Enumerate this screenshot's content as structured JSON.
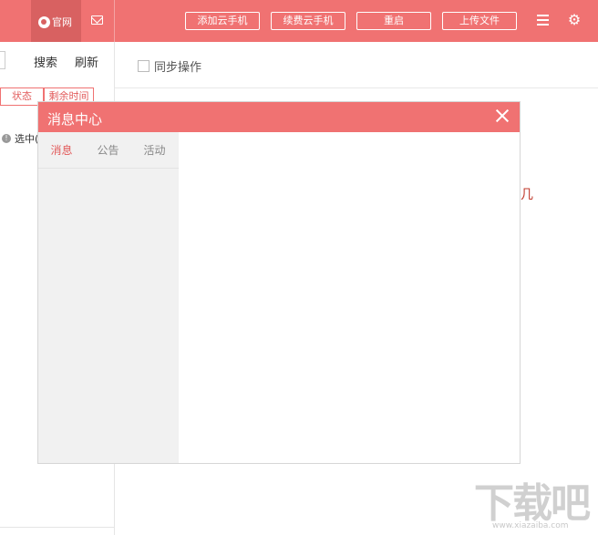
{
  "topbar": {
    "site_label": "官网",
    "buttons": {
      "add_phone": "添加云手机",
      "renew_phone": "续费云手机",
      "restart": "重启",
      "upload_file": "上传文件"
    },
    "icons": [
      "globe-icon",
      "mail-icon",
      "menu-icon",
      "gear-icon"
    ]
  },
  "left_panel": {
    "search_label": "搜索",
    "refresh_label": "刷新",
    "columns": [
      "状态",
      "剩余时间"
    ],
    "info_text": "选中("
  },
  "main": {
    "sync_label": "同步操作",
    "partial_text": "几"
  },
  "modal": {
    "title": "消息中心",
    "tabs": [
      {
        "label": "消息",
        "active": true
      },
      {
        "label": "公告",
        "active": false
      },
      {
        "label": "活动",
        "active": false
      }
    ]
  },
  "watermark": {
    "text": "下载吧",
    "sub": "www.xiazaiba.com"
  },
  "colors": {
    "accent": "#f07272",
    "accent_dark": "#d86161",
    "active_tab": "#e25c5c"
  }
}
